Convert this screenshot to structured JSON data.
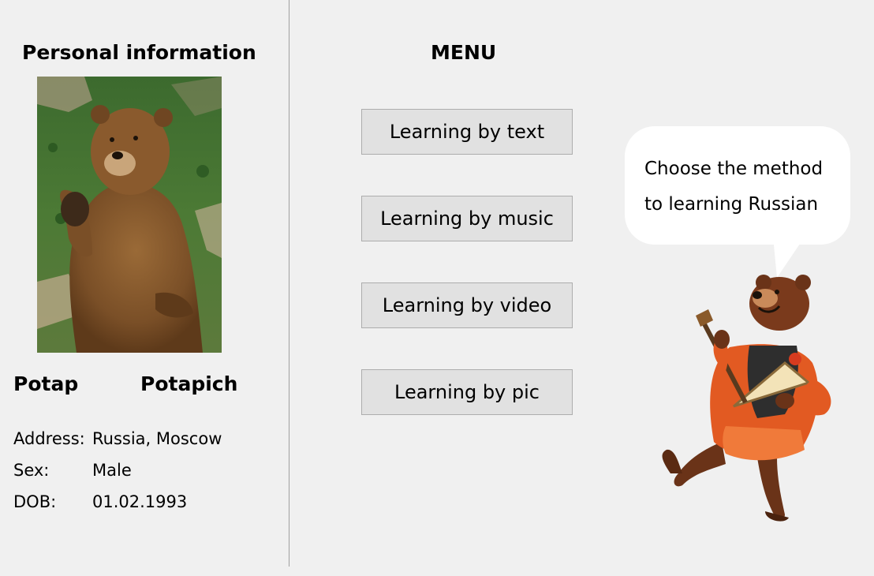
{
  "personal": {
    "title": "Personal information",
    "first_name": "Potap",
    "last_name": "Potapich",
    "fields": [
      {
        "label": "Address:",
        "value": "Russia, Moscow"
      },
      {
        "label": "Sex:",
        "value": "Male"
      },
      {
        "label": "DOB:",
        "value": "01.02.1993"
      }
    ]
  },
  "menu": {
    "title": "MENU",
    "buttons": [
      {
        "label": "Learning by text"
      },
      {
        "label": "Learning by music"
      },
      {
        "label": "Learning by video"
      },
      {
        "label": "Learning by pic"
      }
    ]
  },
  "speech_bubble": {
    "lines": [
      "Choose the method",
      "to learning Russian"
    ]
  },
  "colors": {
    "background": "#f0f0f0",
    "button_face": "#e1e1e1",
    "button_border": "#adadad",
    "divider": "#a0a0a0"
  },
  "icons": {
    "profile_photo": "brown-bear-photo",
    "mascot": "dancing-bear-balalaika"
  }
}
